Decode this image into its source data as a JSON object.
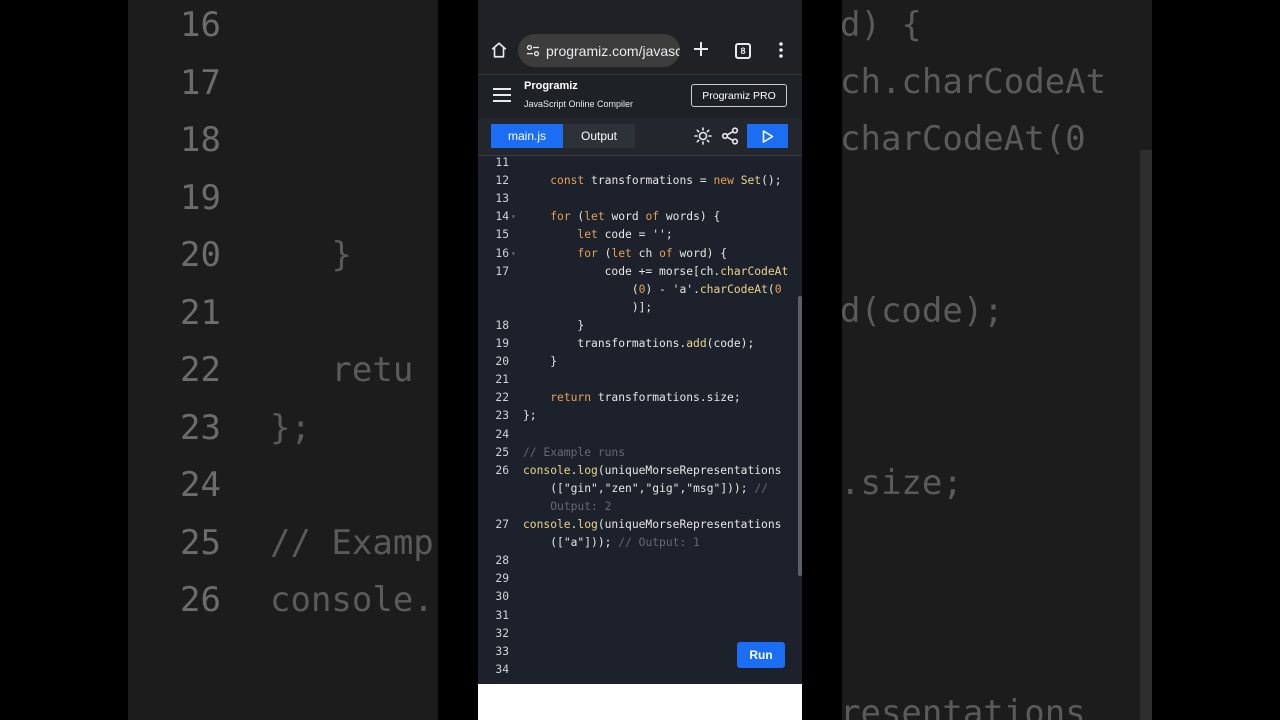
{
  "background_left": [
    {
      "num": "16",
      "text": ""
    },
    {
      "num": "17",
      "text": ""
    },
    {
      "num": "18",
      "text": ""
    },
    {
      "num": "19",
      "text": ""
    },
    {
      "num": "20",
      "text": "   }"
    },
    {
      "num": "21",
      "text": ""
    },
    {
      "num": "22",
      "text": "   retu"
    },
    {
      "num": "23",
      "text": "};"
    },
    {
      "num": "24",
      "text": ""
    },
    {
      "num": "25",
      "text": "// Examp"
    },
    {
      "num": "26",
      "text": "console."
    }
  ],
  "background_right": [
    "d) {",
    "ch.charCodeAt",
    "charCodeAt(0",
    "d(code);",
    ".size;",
    "resentations"
  ],
  "browser": {
    "url": "programiz.com/javasc",
    "tab_count": "8"
  },
  "app": {
    "logo": "Programiz",
    "subtitle": "JavaScript Online Compiler",
    "pro_label": "Programiz PRO"
  },
  "toolbar": {
    "tab_main": "main.js",
    "tab_output": "Output"
  },
  "editor": {
    "run_label": "Run",
    "lines": [
      {
        "n": "11",
        "fold": false,
        "html": ""
      },
      {
        "n": "12",
        "fold": false,
        "html": "    <span class='kw'>const</span> transformations = <span class='kw'>new</span> <span class='fn'>Set</span>();"
      },
      {
        "n": "13",
        "fold": false,
        "html": ""
      },
      {
        "n": "14",
        "fold": true,
        "html": "    <span class='kw'>for</span> (<span class='kw'>let</span> word <span class='kw'>of</span> words) {"
      },
      {
        "n": "15",
        "fold": false,
        "html": "        <span class='kw'>let</span> code = <span class='st'>''</span>;"
      },
      {
        "n": "16",
        "fold": true,
        "html": "        <span class='kw'>for</span> (<span class='kw'>let</span> ch <span class='kw'>of</span> word) {"
      },
      {
        "n": "17",
        "fold": false,
        "html": "            code += morse[ch.<span class='fn'>charCodeAt</span>"
      },
      {
        "n": "",
        "fold": false,
        "html": "                (<span class='num'>0</span>) - <span class='st'>'a'</span>.<span class='fn'>charCodeAt</span>(<span class='num'>0</span>"
      },
      {
        "n": "",
        "fold": false,
        "html": "                )];"
      },
      {
        "n": "18",
        "fold": false,
        "html": "        }"
      },
      {
        "n": "19",
        "fold": false,
        "html": "        transformations.<span class='fn'>add</span>(code);"
      },
      {
        "n": "20",
        "fold": false,
        "html": "    }"
      },
      {
        "n": "21",
        "fold": false,
        "html": ""
      },
      {
        "n": "22",
        "fold": false,
        "html": "    <span class='kw'>return</span> transformations.size;"
      },
      {
        "n": "23",
        "fold": false,
        "html": "};"
      },
      {
        "n": "24",
        "fold": false,
        "html": ""
      },
      {
        "n": "25",
        "fold": false,
        "html": "<span class='cm'>// Example runs</span>"
      },
      {
        "n": "26",
        "fold": false,
        "html": "<span class='fn'>console</span>.<span class='fn'>log</span>(uniqueMorseRepresentations"
      },
      {
        "n": "",
        "fold": false,
        "html": "    ([<span class='st'>\"gin\"</span>,<span class='st'>\"zen\"</span>,<span class='st'>\"gig\"</span>,<span class='st'>\"msg\"</span>])); <span class='cm'>//</span>"
      },
      {
        "n": "",
        "fold": false,
        "html": "    <span class='cm'>Output: 2</span>"
      },
      {
        "n": "27",
        "fold": false,
        "html": "<span class='fn'>console</span>.<span class='fn'>log</span>(uniqueMorseRepresentations"
      },
      {
        "n": "",
        "fold": false,
        "html": "    ([<span class='st'>\"a\"</span>])); <span class='cm'>// Output: 1</span>"
      },
      {
        "n": "28",
        "fold": false,
        "html": ""
      },
      {
        "n": "29",
        "fold": false,
        "html": ""
      },
      {
        "n": "30",
        "fold": false,
        "html": ""
      },
      {
        "n": "31",
        "fold": false,
        "html": ""
      },
      {
        "n": "32",
        "fold": false,
        "html": ""
      },
      {
        "n": "33",
        "fold": false,
        "html": ""
      },
      {
        "n": "34",
        "fold": false,
        "html": ""
      }
    ]
  }
}
